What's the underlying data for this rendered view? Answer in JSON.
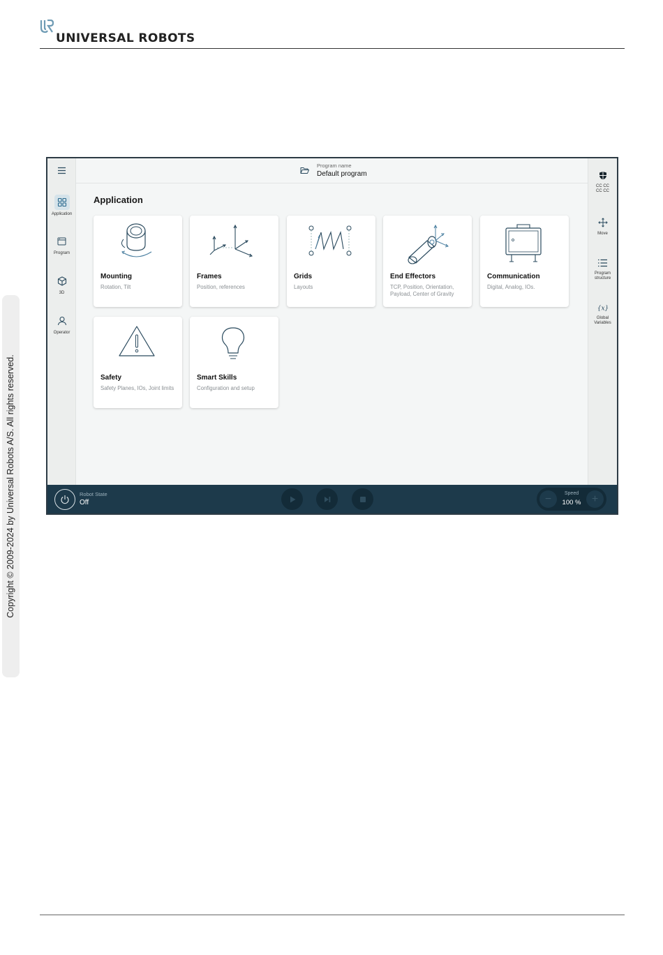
{
  "document": {
    "brand": "UNIVERSAL ROBOTS",
    "copyright": "Copyright © 2009-2024 by Universal Robots A/S. All rights reserved."
  },
  "left_nav": [
    {
      "label": "Application",
      "icon": "grid-icon",
      "active": true
    },
    {
      "label": "Program",
      "icon": "window-icon",
      "active": false
    },
    {
      "label": "3D",
      "icon": "cube-icon",
      "active": false
    },
    {
      "label": "Operator",
      "icon": "person-icon",
      "active": false
    }
  ],
  "top_bar": {
    "program_label": "Program name",
    "program_name": "Default program"
  },
  "right_nav": [
    {
      "label": "CC CC\nCC CC",
      "icon": "shield-icon"
    },
    {
      "label": "Move",
      "icon": "move-arrows-icon"
    },
    {
      "label": "Program\nstructure",
      "icon": "list-icon"
    },
    {
      "label": "Global\nVariables",
      "icon": "variable-icon"
    }
  ],
  "main": {
    "title": "Application",
    "cards": [
      {
        "title": "Mounting",
        "subtitle": "Rotation, Tilt"
      },
      {
        "title": "Frames",
        "subtitle": "Position, references"
      },
      {
        "title": "Grids",
        "subtitle": "Layouts"
      },
      {
        "title": "End Effectors",
        "subtitle": "TCP, Position, Orientation, Payload, Center of Gravity"
      },
      {
        "title": "Communication",
        "subtitle": "Digital, Analog, IOs."
      },
      {
        "title": "Safety",
        "subtitle": "Safety Planes, IOs, Joint limits"
      },
      {
        "title": "Smart Skills",
        "subtitle": "Configuration and setup"
      }
    ]
  },
  "bottom_bar": {
    "robot_state_label": "Robot State",
    "robot_state_value": "Off",
    "speed_label": "Speed",
    "speed_value": "100 %",
    "speed_minus": "−",
    "speed_plus": "+"
  },
  "colors": {
    "accent": "#1d3a4b",
    "active_nav": "#d5e3ea",
    "icon_stroke": "#2a4a5e"
  }
}
